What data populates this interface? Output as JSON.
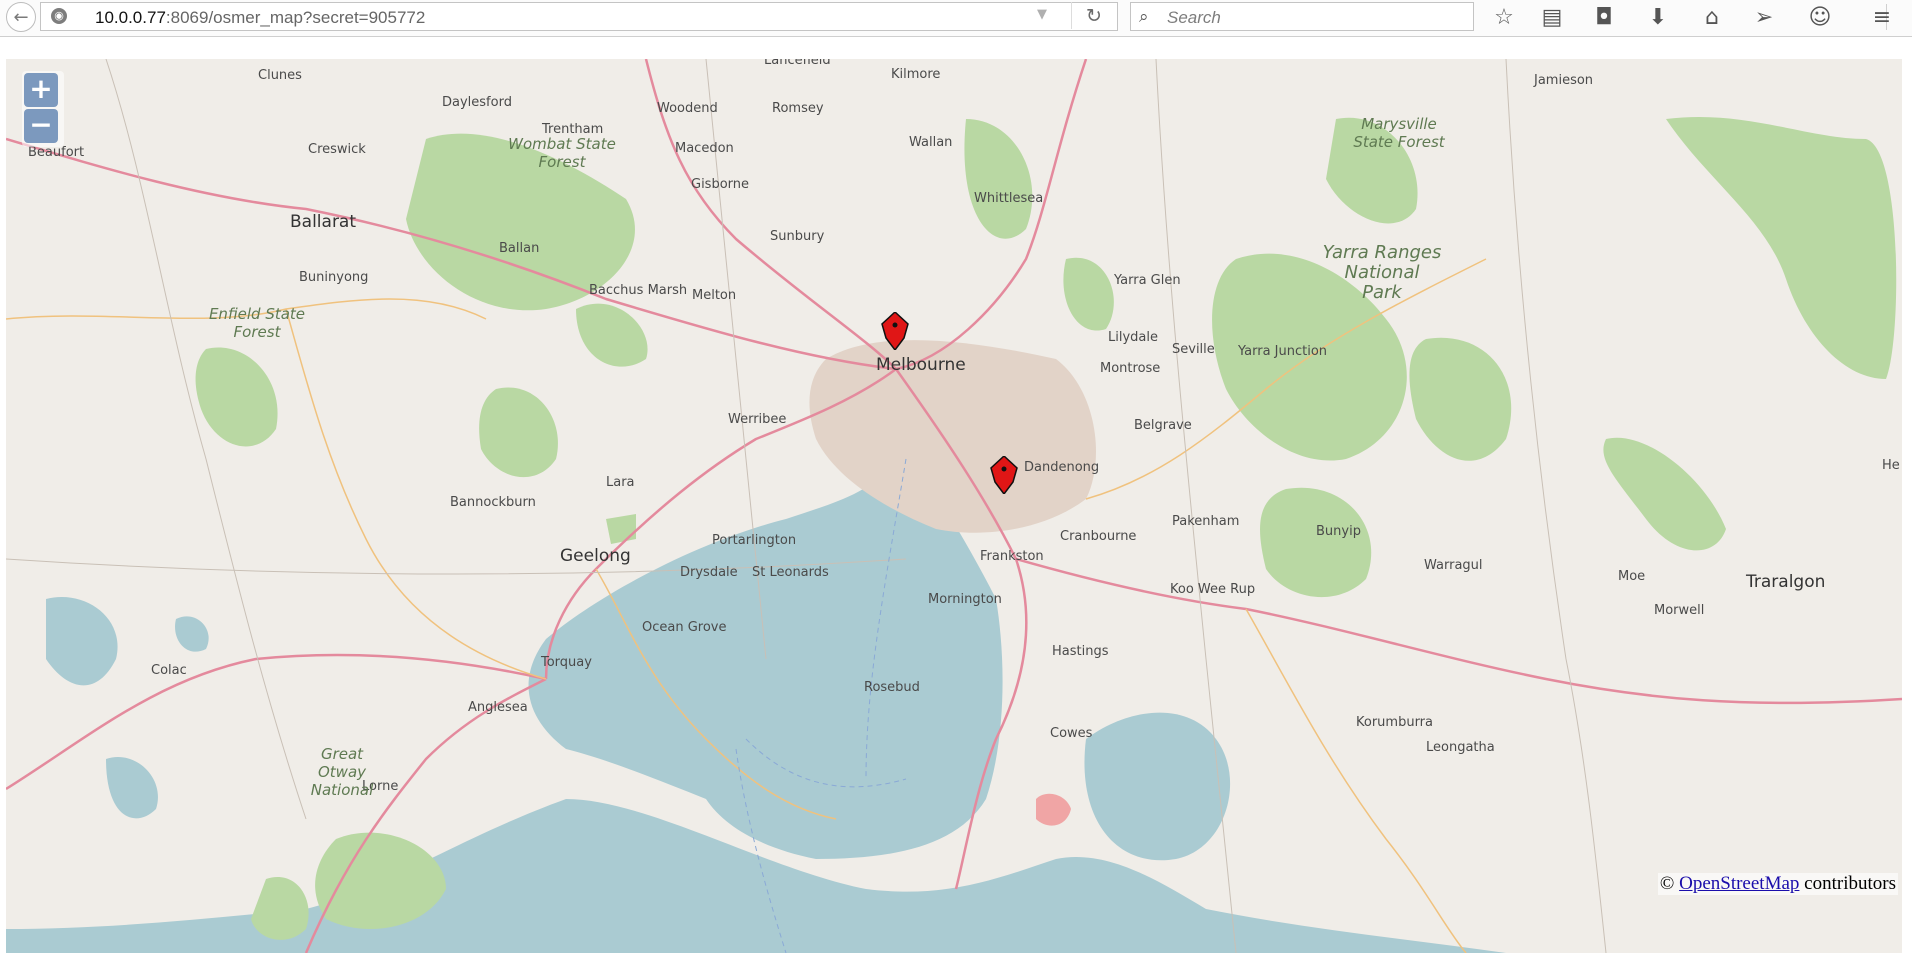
{
  "browser": {
    "url_host": "10.0.0.77",
    "url_rest": ":8069/osmer_map?secret=905772",
    "search_placeholder": "Search"
  },
  "map": {
    "zoom_in_label": "+",
    "zoom_out_label": "−",
    "attribution_prefix": "©",
    "attribution_link": "OpenStreetMap",
    "attribution_suffix": "contributors",
    "major_cities": [
      "Melbourne",
      "Geelong",
      "Ballarat",
      "Traralgon"
    ],
    "towns": [
      "Lancefield",
      "Kilmore",
      "Jamieson",
      "Clunes",
      "Daylesford",
      "Woodend",
      "Romsey",
      "Trentham",
      "Macedon",
      "Wallan",
      "Creswick",
      "Beaufort",
      "Gisborne",
      "Whittlesea",
      "Sunbury",
      "Ballan",
      "Buninyong",
      "Bacchus Marsh",
      "Melton",
      "Yarra Glen",
      "Lilydale",
      "Seville",
      "Yarra Junction",
      "Montrose",
      "Belgrave",
      "Werribee",
      "Dandenong",
      "Lara",
      "Bannockburn",
      "Pakenham",
      "Bunyip",
      "Cranbourne",
      "Portarlington",
      "Frankston",
      "Drysdale",
      "St Leonards",
      "Warragul",
      "Moe",
      "Koo Wee Rup",
      "Morwell",
      "Mornington",
      "Ocean Grove",
      "Torquay",
      "Hastings",
      "Colac",
      "Rosebud",
      "Anglesea",
      "Cowes",
      "Korumburra",
      "Leongatha",
      "Lorne",
      "He"
    ],
    "forests": [
      "Wombat State Forest",
      "Marysville State Forest",
      "Enfield State Forest",
      "Great Otway National"
    ],
    "park": "Yarra Ranges National Park",
    "markers": [
      "location-marker",
      "location-marker"
    ]
  }
}
